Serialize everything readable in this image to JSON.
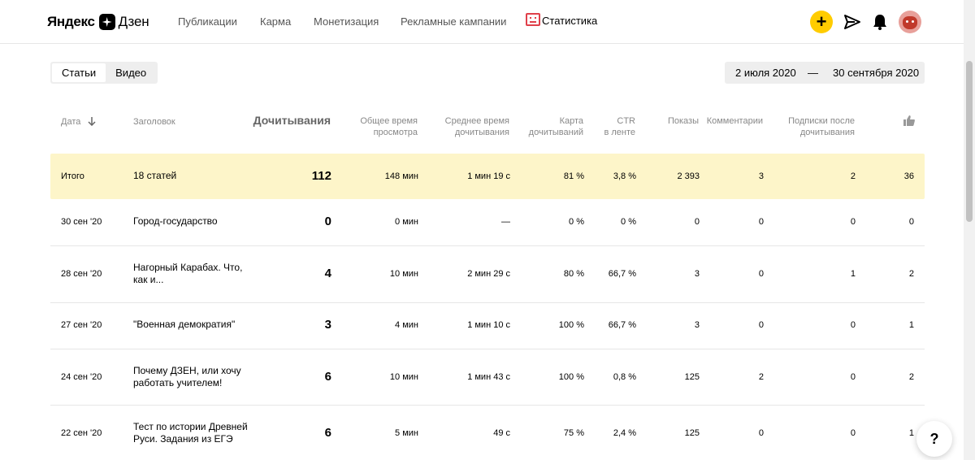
{
  "header": {
    "logo_part1": "Яндекс",
    "logo_part2": "Дзен",
    "nav": [
      {
        "label": "Публикации"
      },
      {
        "label": "Карма"
      },
      {
        "label": "Монетизация"
      },
      {
        "label": "Рекламные кампании"
      },
      {
        "label": "Статистика"
      }
    ],
    "plus_label": "+",
    "accent_color": "#ffcc00",
    "icons": [
      "plus-icon",
      "send-icon",
      "bell-icon",
      "avatar"
    ]
  },
  "toggle": {
    "options": [
      "Статьи",
      "Видео"
    ],
    "active": "Статьи"
  },
  "daterange": {
    "from": "2 июля 2020",
    "separator": "—",
    "to": "30 сентября 2020"
  },
  "table": {
    "columns": {
      "date": "Дата",
      "title": "Заголовок",
      "reads": "Дочитывания",
      "total_time": [
        "Общее время",
        "просмотра"
      ],
      "avg_time": [
        "Среднее время",
        "дочитывания"
      ],
      "map": [
        "Карта",
        "дочитываний"
      ],
      "ctr": [
        "CTR",
        "в ленте"
      ],
      "views": "Показы",
      "comments": "Комментарии",
      "subs": [
        "Подписки после",
        "дочитывания"
      ],
      "likes_icon": "thumbs-up-icon"
    },
    "total": {
      "date": "Итого",
      "title": "18 статей",
      "reads": "112",
      "total_time": "148 мин",
      "avg_time": "1 мин 19 с",
      "map": "81 %",
      "ctr": "3,8 %",
      "views": "2 393",
      "comments": "3",
      "subs": "2",
      "likes": "36"
    },
    "rows": [
      {
        "date": "30 сен '20",
        "title": "Город-государство",
        "reads": "0",
        "total_time": "0 мин",
        "avg_time": "—",
        "map": "0 %",
        "ctr": "0 %",
        "views": "0",
        "comments": "0",
        "subs": "0",
        "likes": "0"
      },
      {
        "date": "28 сен '20",
        "title": "Нагорный Карабах. Что, как и...",
        "reads": "4",
        "total_time": "10 мин",
        "avg_time": "2 мин 29 с",
        "map": "80 %",
        "ctr": "66,7 %",
        "views": "3",
        "comments": "0",
        "subs": "1",
        "likes": "2"
      },
      {
        "date": "27 сен '20",
        "title": "\"Военная демократия\"",
        "reads": "3",
        "total_time": "4 мин",
        "avg_time": "1 мин 10 с",
        "map": "100 %",
        "ctr": "66,7 %",
        "views": "3",
        "comments": "0",
        "subs": "0",
        "likes": "1"
      },
      {
        "date": "24 сен '20",
        "title": "Почему ДЗЕН, или хочу работать учителем!",
        "reads": "6",
        "total_time": "10 мин",
        "avg_time": "1 мин 43 с",
        "map": "100 %",
        "ctr": "0,8 %",
        "views": "125",
        "comments": "2",
        "subs": "0",
        "likes": "2"
      },
      {
        "date": "22 сен '20",
        "title": "Тест по истории Древней Руси. Задания из ЕГЭ",
        "reads": "6",
        "total_time": "5 мин",
        "avg_time": "49 с",
        "map": "75 %",
        "ctr": "2,4 %",
        "views": "125",
        "comments": "0",
        "subs": "0",
        "likes": "1"
      }
    ]
  },
  "help": {
    "label": "?"
  }
}
